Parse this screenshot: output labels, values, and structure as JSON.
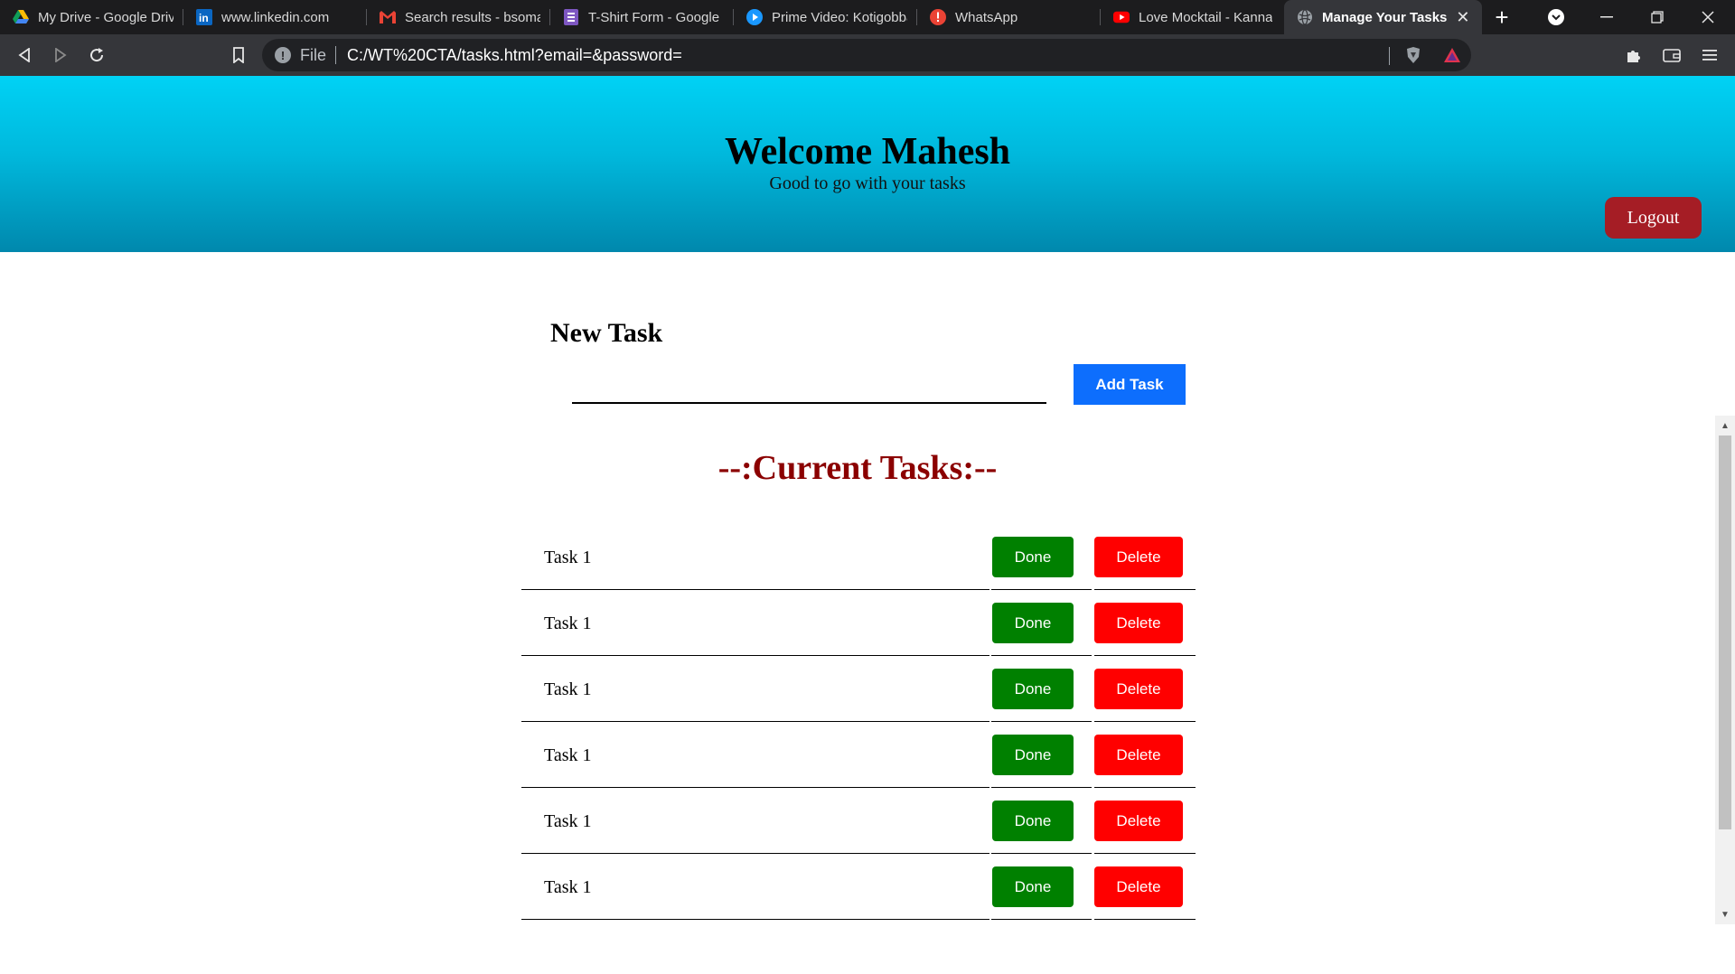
{
  "browser": {
    "tabs": [
      {
        "title": "My Drive - Google Drive",
        "icon": "google-drive-icon"
      },
      {
        "title": "www.linkedin.com",
        "icon": "linkedin-icon"
      },
      {
        "title": "Search results - bsomas",
        "icon": "gmail-icon"
      },
      {
        "title": "T-Shirt Form - Google F",
        "icon": "google-forms-icon"
      },
      {
        "title": "Prime Video: Kotigobba",
        "icon": "prime-video-icon"
      },
      {
        "title": "WhatsApp",
        "icon": "whatsapp-icon"
      },
      {
        "title": "Love Mocktail - Kanna",
        "icon": "youtube-icon"
      }
    ],
    "active_tab": {
      "title": "Manage Your Tasks",
      "close": "✕",
      "icon": "globe-icon"
    },
    "new_tab": "+",
    "address": {
      "scheme_label": "File",
      "url": "C:/WT%20CTA/tasks.html?email=&password="
    }
  },
  "header": {
    "title": "Welcome Mahesh",
    "subtitle": "Good to go with your tasks",
    "logout_label": "Logout"
  },
  "new_task": {
    "heading": "New Task",
    "input_value": "",
    "add_label": "Add Task"
  },
  "current_tasks": {
    "heading": "--:Current Tasks:--",
    "tasks": [
      {
        "name": "Task 1",
        "done_label": "Done",
        "delete_label": "Delete"
      },
      {
        "name": "Task 1",
        "done_label": "Done",
        "delete_label": "Delete"
      },
      {
        "name": "Task 1",
        "done_label": "Done",
        "delete_label": "Delete"
      },
      {
        "name": "Task 1",
        "done_label": "Done",
        "delete_label": "Delete"
      },
      {
        "name": "Task 1",
        "done_label": "Done",
        "delete_label": "Delete"
      },
      {
        "name": "Task 1",
        "done_label": "Done",
        "delete_label": "Delete"
      }
    ]
  },
  "colors": {
    "header_gradient_top": "#00d2f5",
    "header_gradient_bottom": "#0088ad",
    "logout": "#a51d25",
    "add_task": "#0d6efd",
    "current_tasks_heading": "#8b0000",
    "done": "#008000",
    "delete": "#ff0000"
  }
}
